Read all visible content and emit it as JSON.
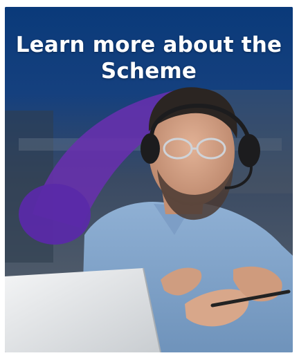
{
  "promo": {
    "headline": "Learn more about the Scheme",
    "colors": {
      "top_band": "#0b3b78",
      "purple_arc": "#6a2fb0",
      "purple_blob": "#5a2aa8",
      "headline_text": "#ffffff"
    },
    "photo": {
      "description_icon": "person-on-headset-call-photo",
      "headset_icon": "headset-icon",
      "laptop_icon": "laptop-icon",
      "pen_icon": "pen-icon"
    }
  }
}
